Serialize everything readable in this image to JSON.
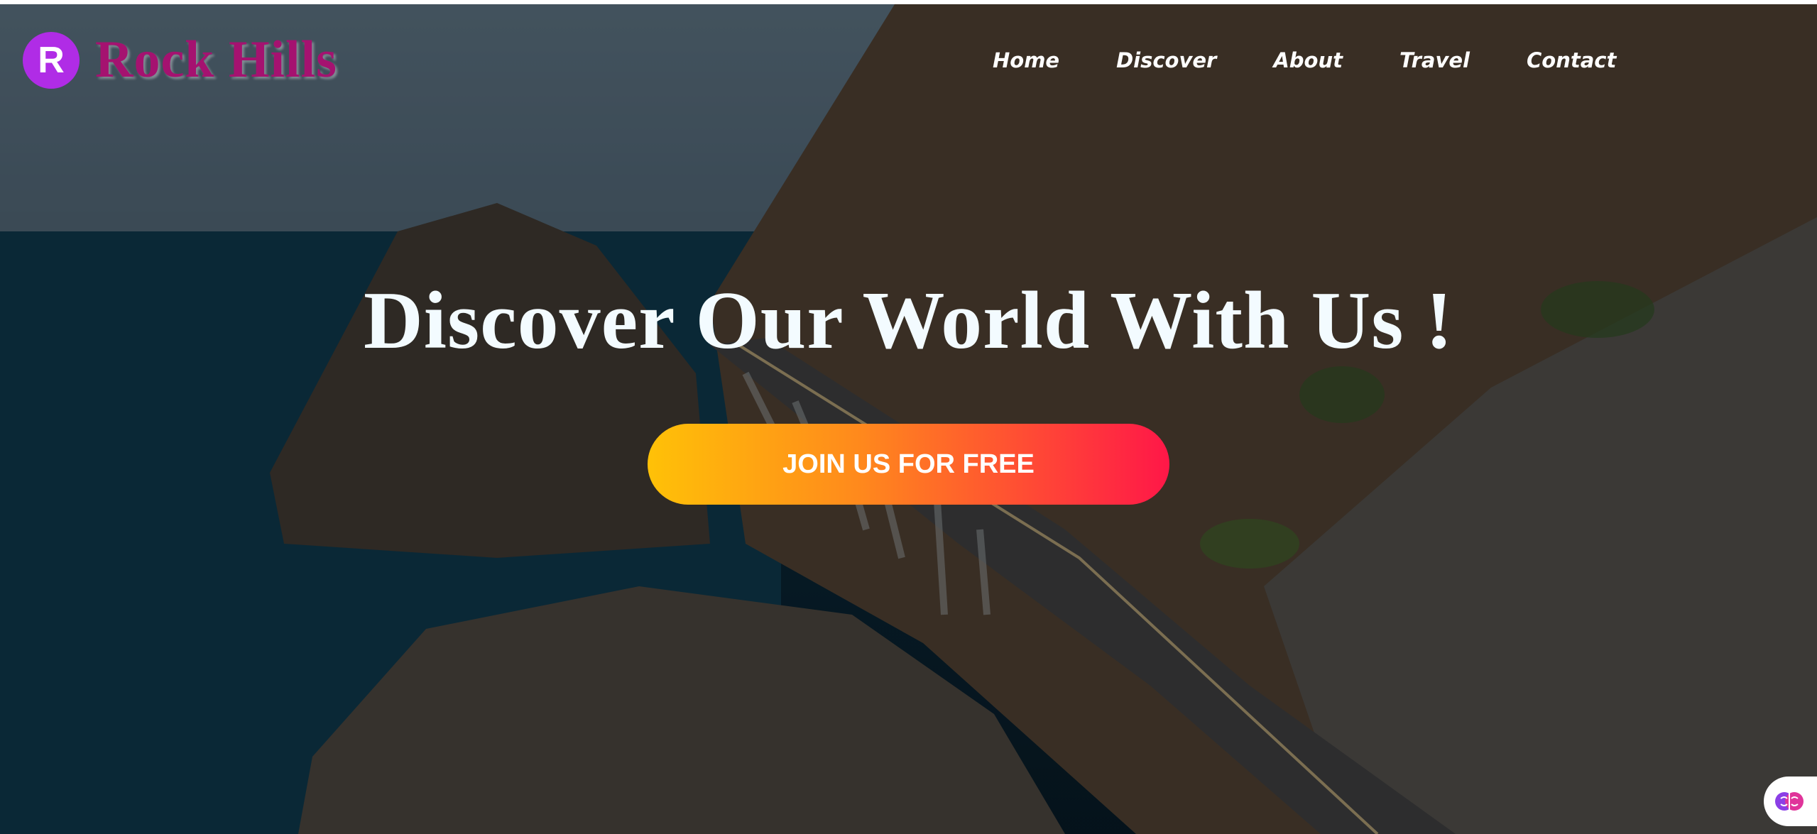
{
  "brand": {
    "logo_letter": "R",
    "name": "Rock Hills"
  },
  "nav": {
    "items": [
      {
        "label": "Home"
      },
      {
        "label": "Discover"
      },
      {
        "label": "About"
      },
      {
        "label": "Travel"
      },
      {
        "label": "Contact"
      }
    ]
  },
  "hero": {
    "headline": "Discover Our World With Us !",
    "cta_label": "JOIN US FOR FREE"
  },
  "colors": {
    "logo_badge": "#b02ce6",
    "logo_text": "#a51270",
    "cta_start": "#ffc107",
    "cta_end": "#ff1748"
  },
  "icons": {
    "assistant": "brain-icon"
  }
}
